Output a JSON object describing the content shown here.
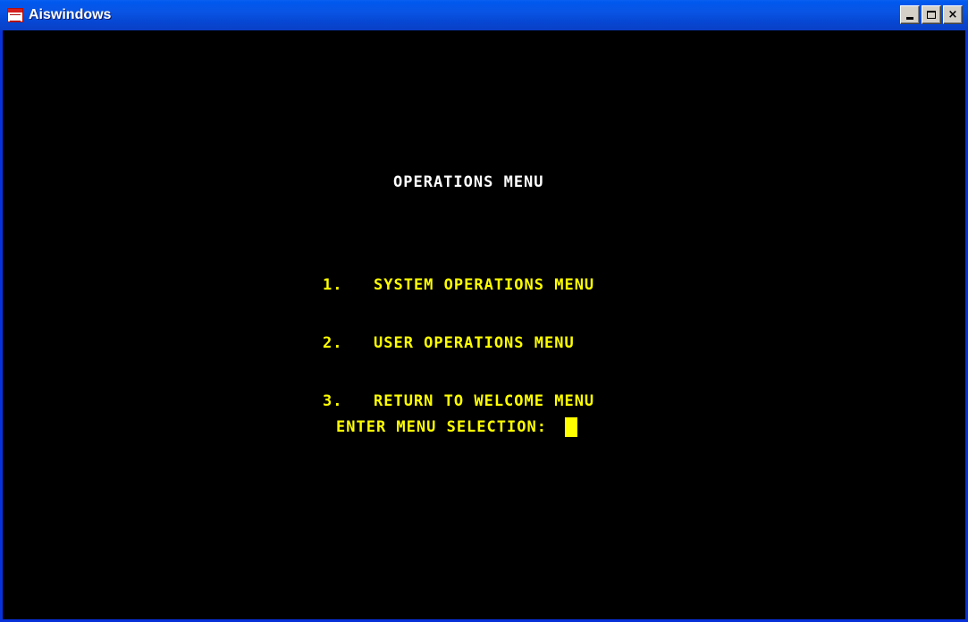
{
  "window": {
    "title": "Aiswindows",
    "controls": [
      "minimize",
      "maximize",
      "close"
    ],
    "close_label": "×"
  },
  "screen": {
    "title": "OPERATIONS MENU",
    "menu": [
      {
        "number": "1.",
        "label": "SYSTEM OPERATIONS MENU"
      },
      {
        "number": "2.",
        "label": "USER OPERATIONS MENU"
      },
      {
        "number": "3.",
        "label": "RETURN TO WELCOME MENU"
      }
    ],
    "prompt": "ENTER MENU SELECTION:",
    "colors": {
      "background": "#000000",
      "title_text": "#ffffff",
      "menu_text": "#ffff00",
      "cursor": "#ffff00"
    }
  }
}
